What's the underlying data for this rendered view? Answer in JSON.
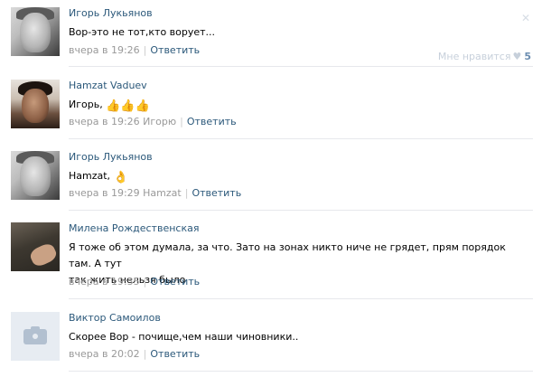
{
  "comments": [
    {
      "author": "Игорь Лукьянов",
      "text": "Вор-это не тот,кто ворует...",
      "time": "вчера в 19:26",
      "reply_to": "",
      "reply_label": "Ответить",
      "like_label": "Мне нравится",
      "like_count": "5"
    },
    {
      "author": "Hamzat Vaduev",
      "text": "Игорь,",
      "emojis": [
        "thumbs-up-emoji",
        "thumbs-up-emoji",
        "thumbs-up-emoji"
      ],
      "time": "вчера в 19:26",
      "reply_to": "Игорю",
      "reply_label": "Ответить"
    },
    {
      "author": "Игорь Лукьянов",
      "text": "Hamzat,",
      "emojis": [
        "ok-hand-emoji"
      ],
      "time": "вчера в 19:29",
      "reply_to": "Hamzat",
      "reply_label": "Ответить"
    },
    {
      "author": "Милена Рождественская",
      "text_line1": "Я тоже об этом думала, за что. Зато на зонах никто ниче не грядет, прям порядок там. А тут",
      "text_line2": "так жить нельзя было",
      "time": "вчера в 19:35",
      "reply_to": "",
      "reply_label": "Ответить"
    },
    {
      "author": "Виктор Самоилов",
      "text": "Скорее Вор - почище,чем наши чиновники..",
      "time": "вчера в 20:02",
      "reply_to": "",
      "reply_label": "Ответить"
    }
  ],
  "colors": {
    "link": "#2b587a",
    "meta": "#999999",
    "divider": "#e7e8ec",
    "like_count": "#6b8db0"
  }
}
